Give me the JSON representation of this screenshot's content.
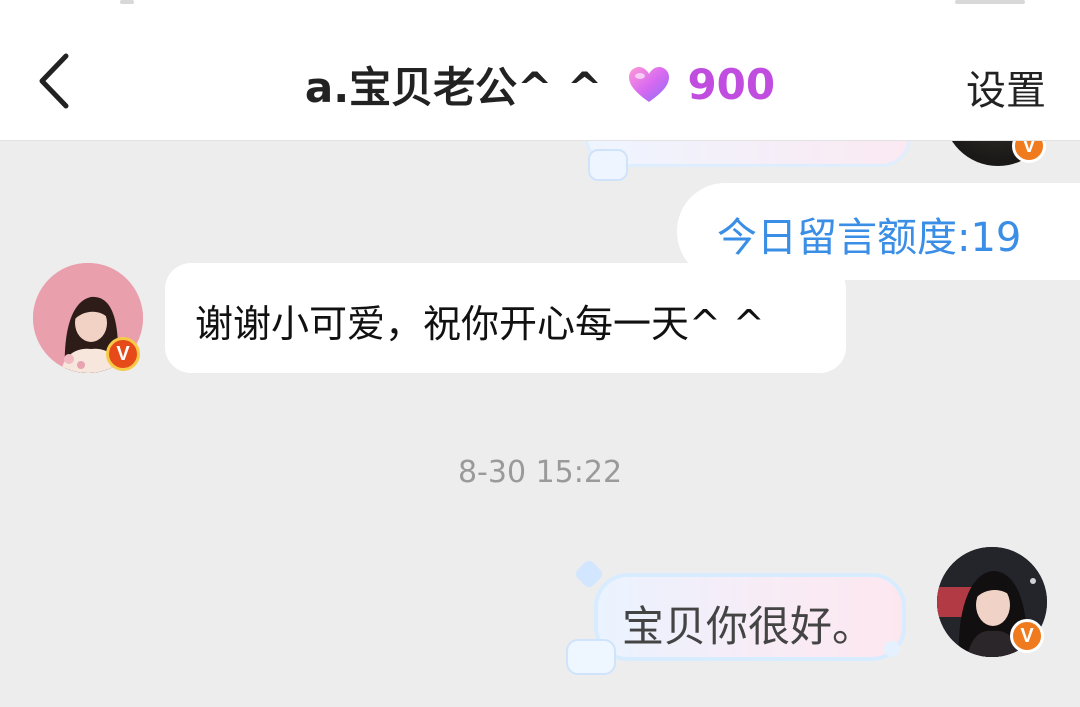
{
  "header": {
    "title": "a.宝贝老公^ ^",
    "intimacy_value": "900",
    "settings_label": "设置"
  },
  "messages": {
    "quota_text": "今日留言额度:19",
    "incoming_text": "谢谢小可爱，祝你开心每一天^ ^",
    "timestamp": "8-30 15:22",
    "outgoing_text": "宝贝你很好。"
  },
  "badges": {
    "verified_letter": "V"
  },
  "colors": {
    "accent_blue": "#3a8ee6",
    "intimacy_purple": "#c14de0",
    "badge_orange": "#f07a1e",
    "chat_background": "#ededed"
  },
  "icons": [
    "back-arrow-icon",
    "heart-icon",
    "verified-icon"
  ]
}
